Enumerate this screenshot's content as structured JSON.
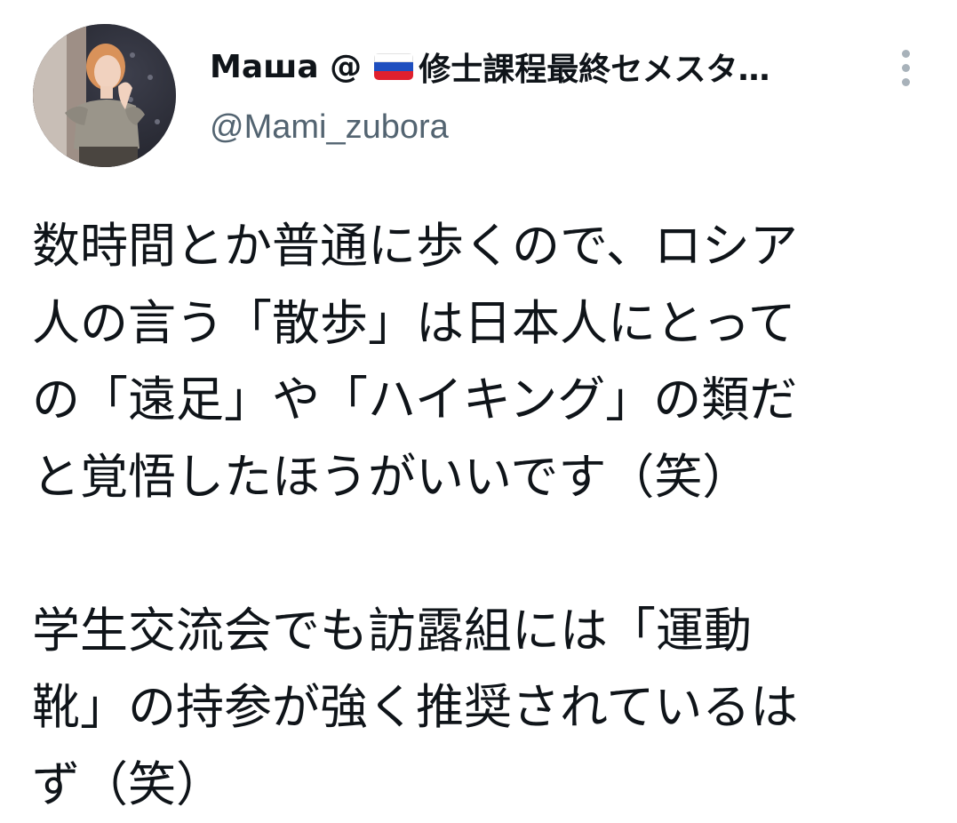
{
  "author": {
    "display_name": "Маша @",
    "display_name_suffix": "修士課程最終セメスタ…",
    "handle": "@Mami_zubora",
    "flag": {
      "name": "russia-flag-icon",
      "colors": [
        "#ffffff",
        "#1f4fbf",
        "#e0202e"
      ]
    },
    "avatar_icon": "profile-photo"
  },
  "menu": {
    "icon": "more-vertical-icon",
    "color": "#a8b2ba"
  },
  "tweet": {
    "paragraph_1": [
      "数時間とか普通に歩くので、ロシア",
      "人の言う「散歩」は日本人にとって",
      "の「遠足」や「ハイキング」の類だ",
      "と覚悟したほうがいいです（笑）"
    ],
    "paragraph_2": [
      "学生交流会でも訪露組には「運動",
      "靴」の持参が強く推奨されているは",
      "ず（笑）"
    ]
  },
  "colors": {
    "text": "#0f1419",
    "secondary": "#536471",
    "background": "#ffffff"
  }
}
